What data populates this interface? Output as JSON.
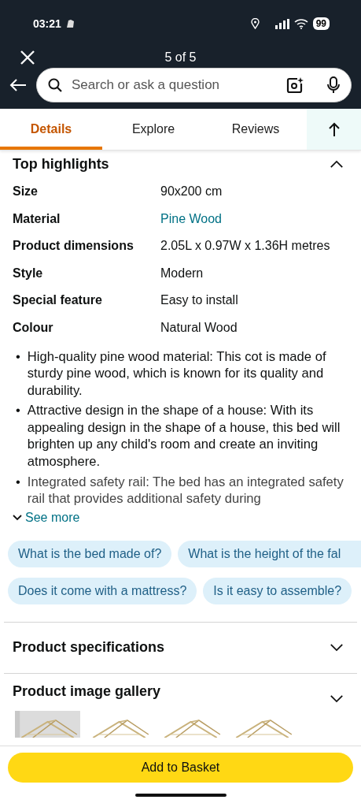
{
  "status_bar": {
    "time": "03:21",
    "battery": "99"
  },
  "header": {
    "counter": "5 of 5",
    "search": {
      "placeholder": "Search or ask a question"
    }
  },
  "tabs": [
    {
      "label": "Details",
      "selected": true
    },
    {
      "label": "Explore",
      "selected": false
    },
    {
      "label": "Reviews",
      "selected": false
    }
  ],
  "highlights": {
    "title": "Top highlights",
    "expanded": true,
    "rows": [
      {
        "label": "Size",
        "value": "90x200 cm",
        "kind": "text"
      },
      {
        "label": "Material",
        "value": "Pine Wood",
        "kind": "link"
      },
      {
        "label": "Product dimensions",
        "value": "2.05L x 0.97W x 1.36H metres",
        "kind": "text"
      },
      {
        "label": "Style",
        "value": "Modern",
        "kind": "text"
      },
      {
        "label": "Special feature",
        "value": "Easy to install",
        "kind": "text"
      },
      {
        "label": "Colour",
        "value": "Natural Wood",
        "kind": "text"
      }
    ],
    "bullets": [
      {
        "marker": "•",
        "text": "High-quality pine wood material: This cot is made of sturdy pine wood, which is known for its quality and durability."
      },
      {
        "marker": "•",
        "text": "Attractive design in the shape of a house: With its appealing design in the shape of a house, this bed will brighten up any child's room and create an inviting atmosphere."
      },
      {
        "marker": "•",
        "text": "Integrated safety rail: The bed has an integrated safety rail that provides additional safety during"
      }
    ],
    "see_more": "See more"
  },
  "questions": [
    [
      {
        "text": "What is the bed made of?",
        "kind": "whole"
      },
      {
        "text": "What is the height of the fal",
        "kind": "cut"
      }
    ],
    [
      {
        "text": "Does it come with a mattress?",
        "kind": "whole"
      },
      {
        "text": "Is it easy to assemble?",
        "kind": "whole"
      }
    ]
  ],
  "sections": [
    {
      "title": "Product specifications",
      "expanded": false
    },
    {
      "title": "Product image gallery",
      "expanded": false
    }
  ],
  "gallery": [
    {
      "kind": "picture"
    },
    {
      "kind": "picture"
    },
    {
      "kind": "picture"
    },
    {
      "kind": "picture"
    }
  ],
  "add_button": "Add to Basket"
}
